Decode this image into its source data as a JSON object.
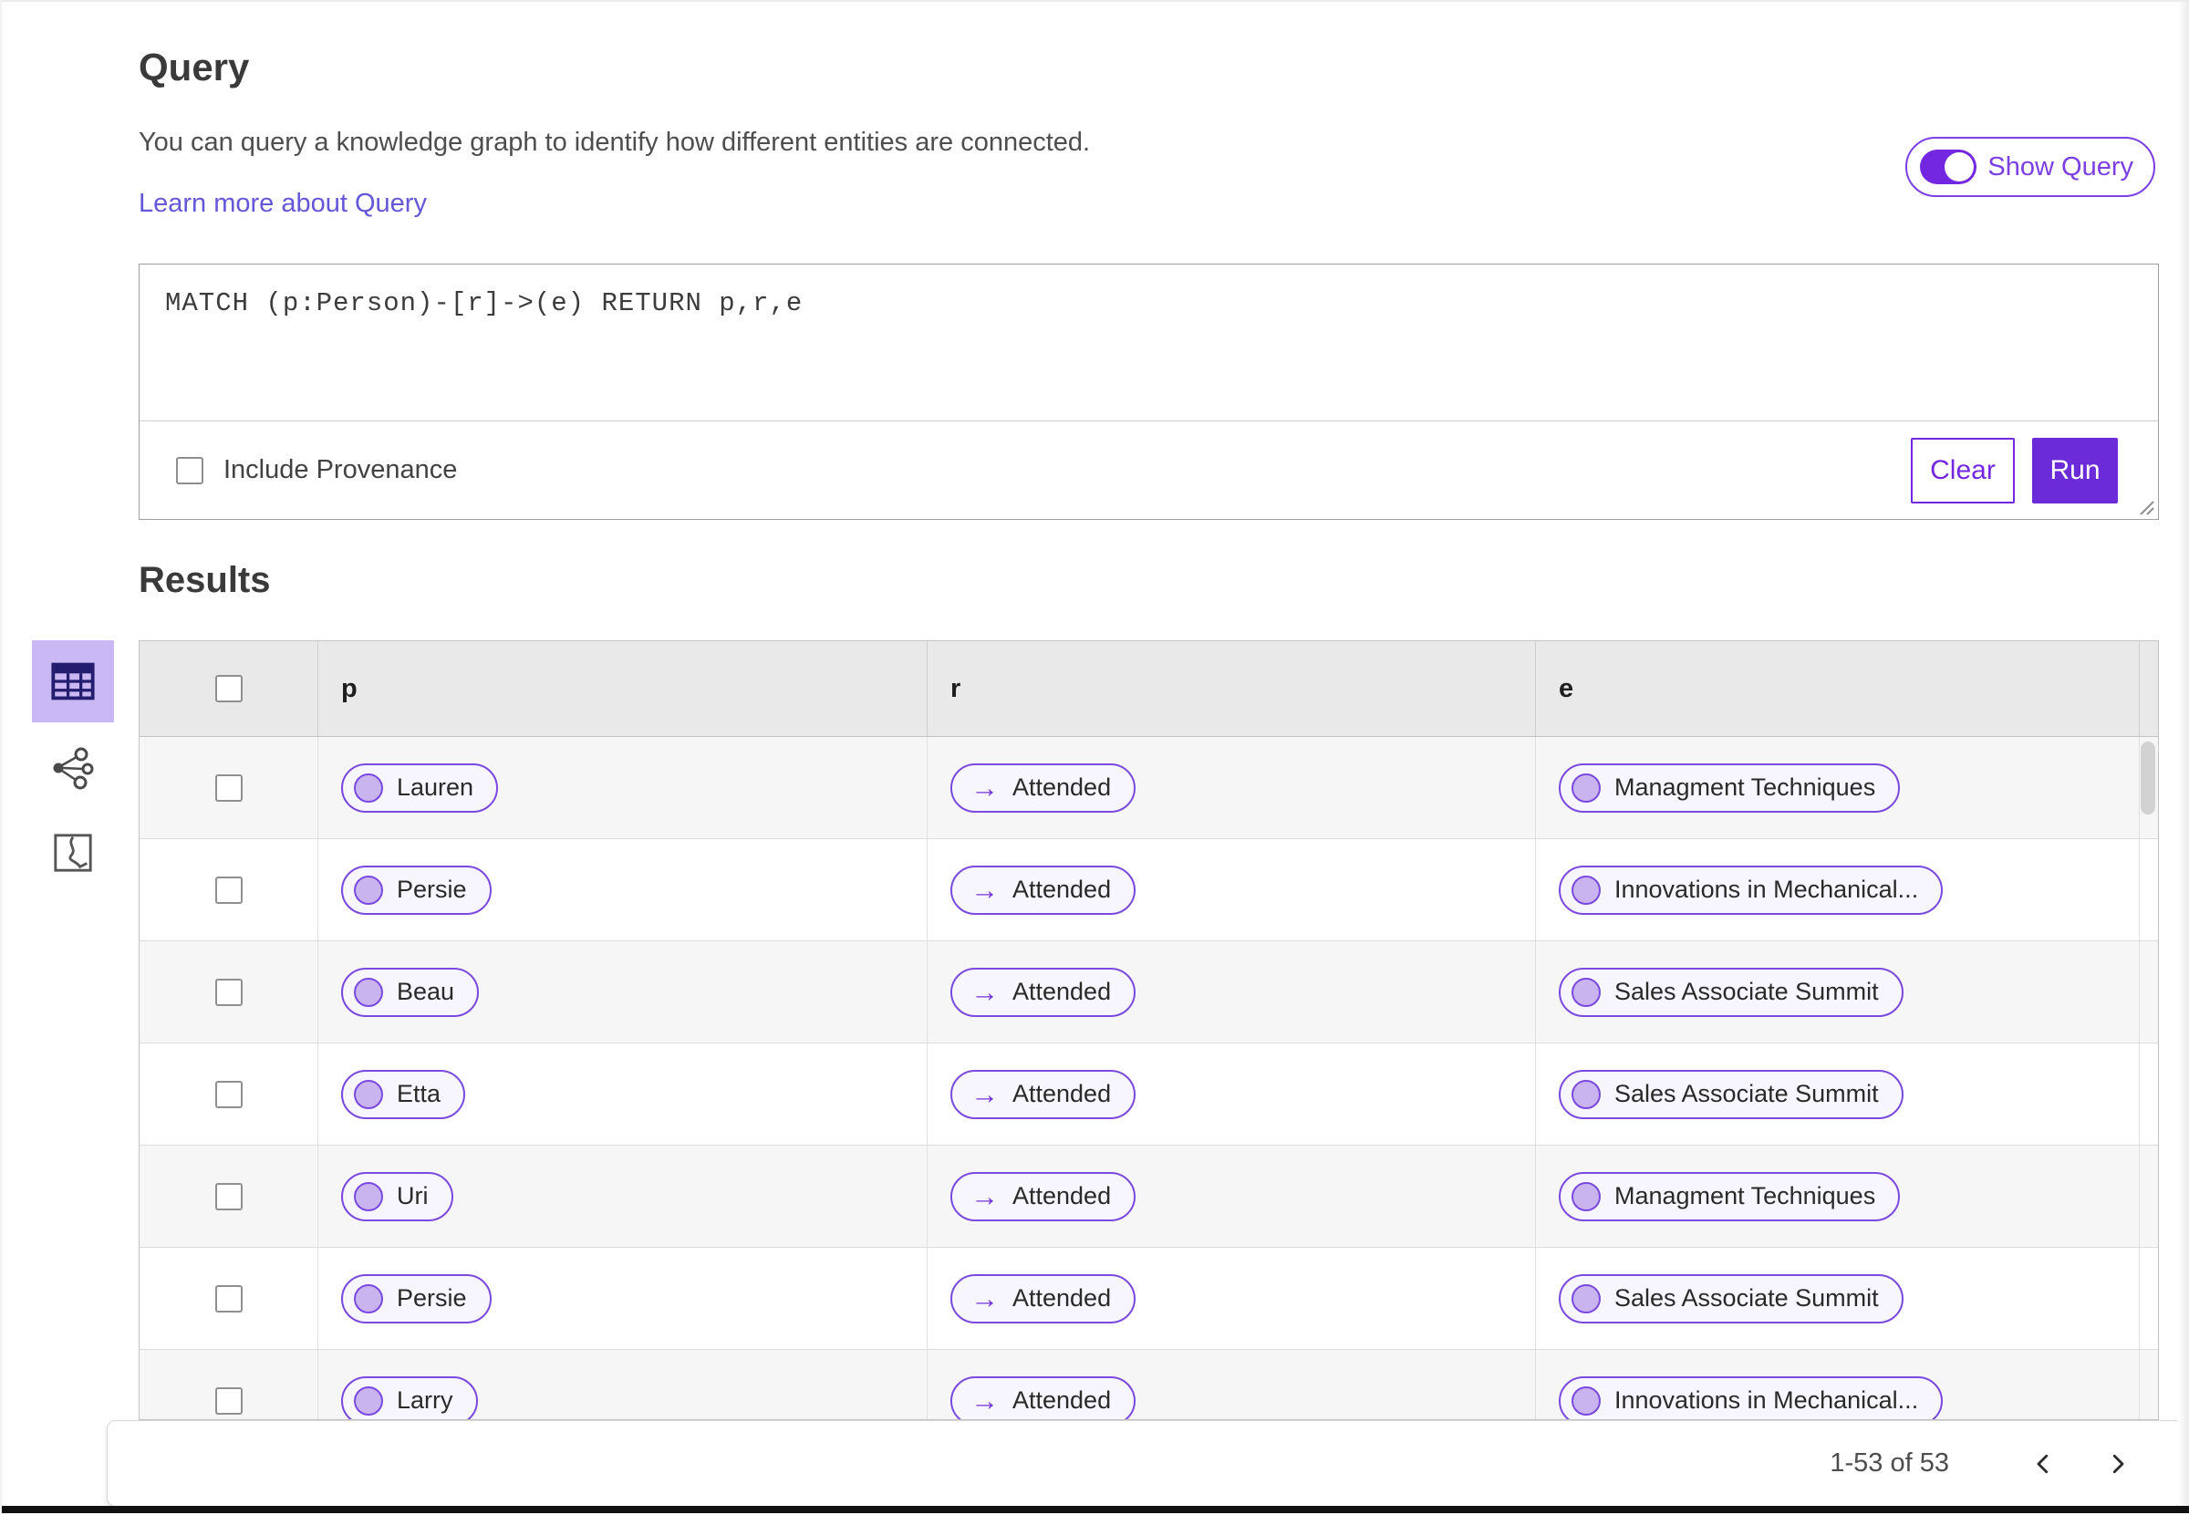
{
  "header": {
    "title": "Query",
    "description": "You can query a knowledge graph to identify how different entities are connected.",
    "learn_more_label": "Learn more about Query",
    "show_query_label": "Show Query",
    "show_query_state": "on"
  },
  "query_editor": {
    "query_text": "MATCH (p:Person)-[r]->(e) RETURN p,r,e",
    "include_provenance_label": "Include Provenance",
    "include_provenance_checked": false,
    "clear_label": "Clear",
    "run_label": "Run"
  },
  "results": {
    "heading": "Results",
    "view_switcher": {
      "items": [
        "table-view",
        "graph-view",
        "map-view"
      ],
      "selected": "table-view"
    },
    "columns": [
      "p",
      "r",
      "e"
    ],
    "rows": [
      {
        "p": "Lauren",
        "r": "Attended",
        "e": "Managment Techniques"
      },
      {
        "p": "Persie",
        "r": "Attended",
        "e": "Innovations in Mechanical..."
      },
      {
        "p": "Beau",
        "r": "Attended",
        "e": "Sales Associate Summit"
      },
      {
        "p": "Etta",
        "r": "Attended",
        "e": "Sales Associate Summit"
      },
      {
        "p": "Uri",
        "r": "Attended",
        "e": "Managment Techniques"
      },
      {
        "p": "Persie",
        "r": "Attended",
        "e": "Sales Associate Summit"
      },
      {
        "p": "Larry",
        "r": "Attended",
        "e": "Innovations in Mechanical..."
      }
    ],
    "pagination": {
      "range_text": "1-53 of 53"
    }
  },
  "icons": {
    "relation_arrow": "→"
  },
  "colors": {
    "accent_purple": "#7327e0",
    "run_button": "#6c2bd9",
    "pill_border": "#7a49de",
    "pill_background": "#f7f5fe",
    "pill_dot": "#c9b4f0",
    "selected_view_background": "#c9b8f4",
    "link": "#6457d8",
    "table_header_background": "#e9e9e9",
    "row_stripe": "#f6f6f6"
  }
}
